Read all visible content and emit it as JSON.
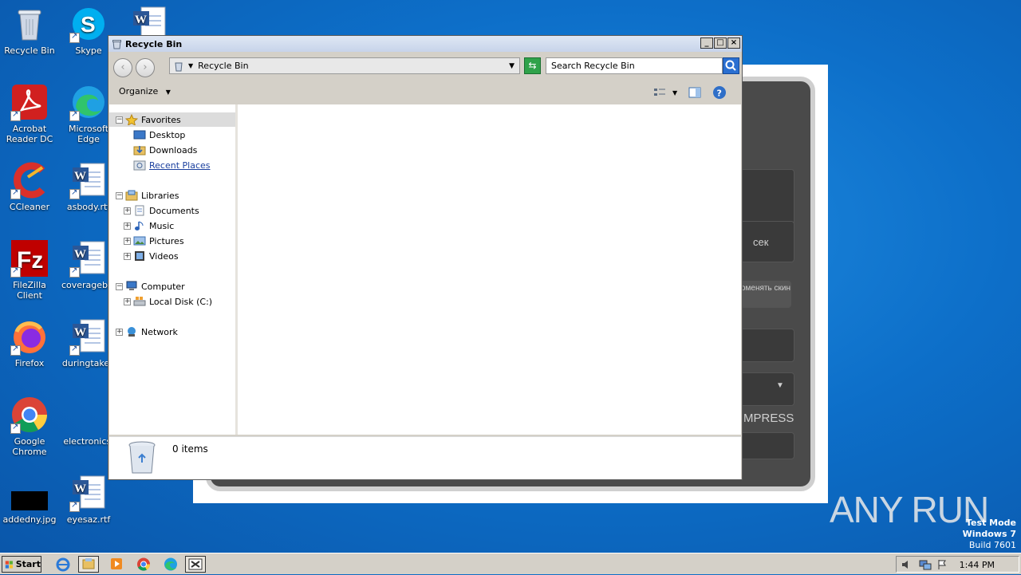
{
  "desktop": {
    "icons": [
      {
        "label": "Recycle Bin",
        "icon": "recycle-bin-icon"
      },
      {
        "label": "Skype",
        "icon": "skype-icon"
      },
      {
        "label": "",
        "icon": "word-document-icon"
      },
      {
        "label": "Acrobat Reader DC",
        "icon": "acrobat-icon"
      },
      {
        "label": "Microsoft Edge",
        "icon": "edge-icon"
      },
      {
        "label": "CCleaner",
        "icon": "ccleaner-icon"
      },
      {
        "label": "asbody.rtf",
        "icon": "word-document-icon"
      },
      {
        "label": "FileZilla Client",
        "icon": "filezilla-icon"
      },
      {
        "label": "coveragebib",
        "icon": "word-document-icon"
      },
      {
        "label": "Firefox",
        "icon": "firefox-icon"
      },
      {
        "label": "duringtaken",
        "icon": "word-document-icon"
      },
      {
        "label": "Google Chrome",
        "icon": "chrome-icon"
      },
      {
        "label": "electronics.",
        "icon": "blank-file-icon"
      },
      {
        "label": "addedny.jpg",
        "icon": "image-file-icon"
      },
      {
        "label": "eyesaz.rtf",
        "icon": "word-document-icon"
      }
    ]
  },
  "background_app": {
    "labels": {
      "sec": "сек",
      "change_skin": "оменять скин",
      "compress": "MPRESS"
    }
  },
  "explorer": {
    "title": "Recycle Bin",
    "address": "Recycle Bin",
    "search_placeholder": "Search Recycle Bin",
    "organize_label": "Organize",
    "nav": {
      "favorites": "Favorites",
      "favorites_items": [
        "Desktop",
        "Downloads",
        "Recent Places"
      ],
      "libraries": "Libraries",
      "libraries_items": [
        "Documents",
        "Music",
        "Pictures",
        "Videos"
      ],
      "computer": "Computer",
      "computer_items": [
        "Local Disk (C:)"
      ],
      "network": "Network"
    },
    "status": "0 items"
  },
  "taskbar": {
    "start_label": "Start",
    "clock": "1:44 PM"
  },
  "watermark": {
    "line1": "Test Mode",
    "line2": "Windows 7",
    "line3": "Build 7601",
    "brand": "ANY RUN"
  },
  "colors": {
    "desktop_blue": "#0d6fc9",
    "window_chrome": "#d4d0c8",
    "link_blue": "#1a3f9e"
  }
}
